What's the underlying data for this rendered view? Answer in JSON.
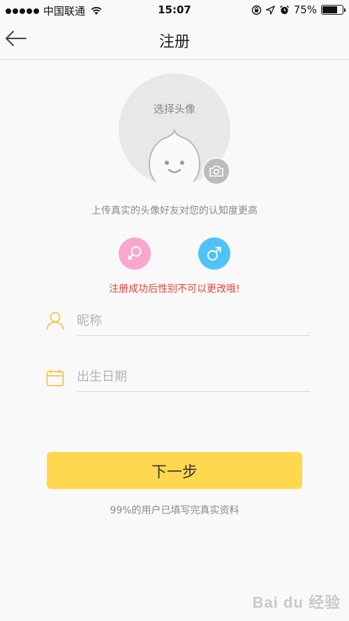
{
  "status_bar": {
    "carrier": "中国联通",
    "time": "15:07",
    "battery_percent": "75%",
    "battery_level": 0.75
  },
  "nav": {
    "title": "注册",
    "back_icon": "arrow-left-icon"
  },
  "avatar": {
    "label": "选择头像",
    "camera_icon": "camera-icon"
  },
  "hint": "上传真实的头像好友对您的认知度更高",
  "gender": {
    "female_icon": "female-symbol-icon",
    "male_icon": "male-symbol-icon",
    "female_color": "#f7a8cc",
    "male_color": "#4fc3f7",
    "warning": "注册成功后性别不可以更改哦!"
  },
  "form": {
    "nickname_placeholder": "昵称",
    "birthdate_placeholder": "出生日期"
  },
  "next_button": "下一步",
  "footer_note": "99%的用户已填写完真实资料",
  "watermark": "Bai du 经验",
  "colors": {
    "accent": "#ffd84f",
    "icon": "#f5c44a",
    "warning": "#e8433a"
  }
}
